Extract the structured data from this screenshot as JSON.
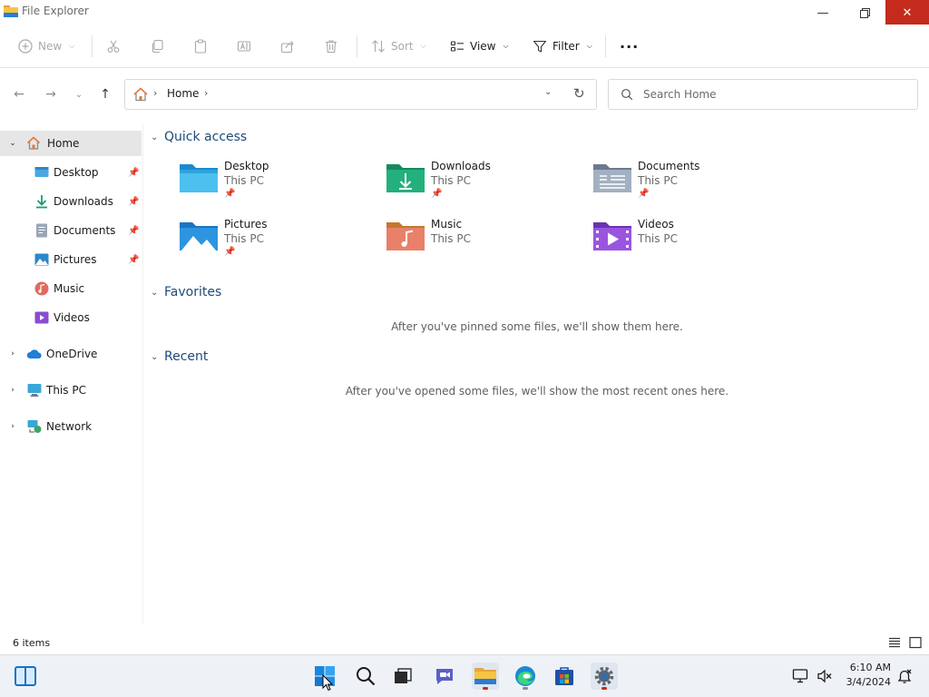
{
  "window": {
    "title": "File Explorer"
  },
  "toolbar": {
    "new_label": "New",
    "sort_label": "Sort",
    "view_label": "View",
    "filter_label": "Filter",
    "more_label": "···"
  },
  "address": {
    "crumb": "Home"
  },
  "search": {
    "placeholder": "Search Home",
    "value": ""
  },
  "sidebar": {
    "home": "Home",
    "items": [
      {
        "label": "Desktop",
        "icon": "desktop-icon",
        "pinned": true
      },
      {
        "label": "Downloads",
        "icon": "downloads-icon",
        "pinned": true
      },
      {
        "label": "Documents",
        "icon": "documents-icon",
        "pinned": true
      },
      {
        "label": "Pictures",
        "icon": "pictures-icon",
        "pinned": true
      },
      {
        "label": "Music",
        "icon": "music-icon",
        "pinned": false
      },
      {
        "label": "Videos",
        "icon": "videos-icon",
        "pinned": false
      }
    ],
    "roots": [
      {
        "label": "OneDrive",
        "icon": "onedrive-icon"
      },
      {
        "label": "This PC",
        "icon": "this-pc-icon"
      },
      {
        "label": "Network",
        "icon": "network-icon"
      }
    ]
  },
  "main": {
    "sections": {
      "quick_access": "Quick access",
      "favorites": "Favorites",
      "recent": "Recent"
    },
    "quick_access": [
      {
        "name": "Desktop",
        "location": "This PC",
        "pinned": true
      },
      {
        "name": "Downloads",
        "location": "This PC",
        "pinned": true
      },
      {
        "name": "Documents",
        "location": "This PC",
        "pinned": true
      },
      {
        "name": "Pictures",
        "location": "This PC",
        "pinned": true
      },
      {
        "name": "Music",
        "location": "This PC",
        "pinned": false
      },
      {
        "name": "Videos",
        "location": "This PC",
        "pinned": false
      }
    ],
    "favorites_empty": "After you've pinned some files, we'll show them here.",
    "recent_empty": "After you've opened some files, we'll show the most recent ones here."
  },
  "status": {
    "item_count": "6 items"
  },
  "clock": {
    "time": "6:10 AM",
    "date": "3/4/2024"
  },
  "colors": {
    "accent": "#1e4a7a",
    "close": "#c42b1c",
    "selected": "#e6e6e6"
  }
}
